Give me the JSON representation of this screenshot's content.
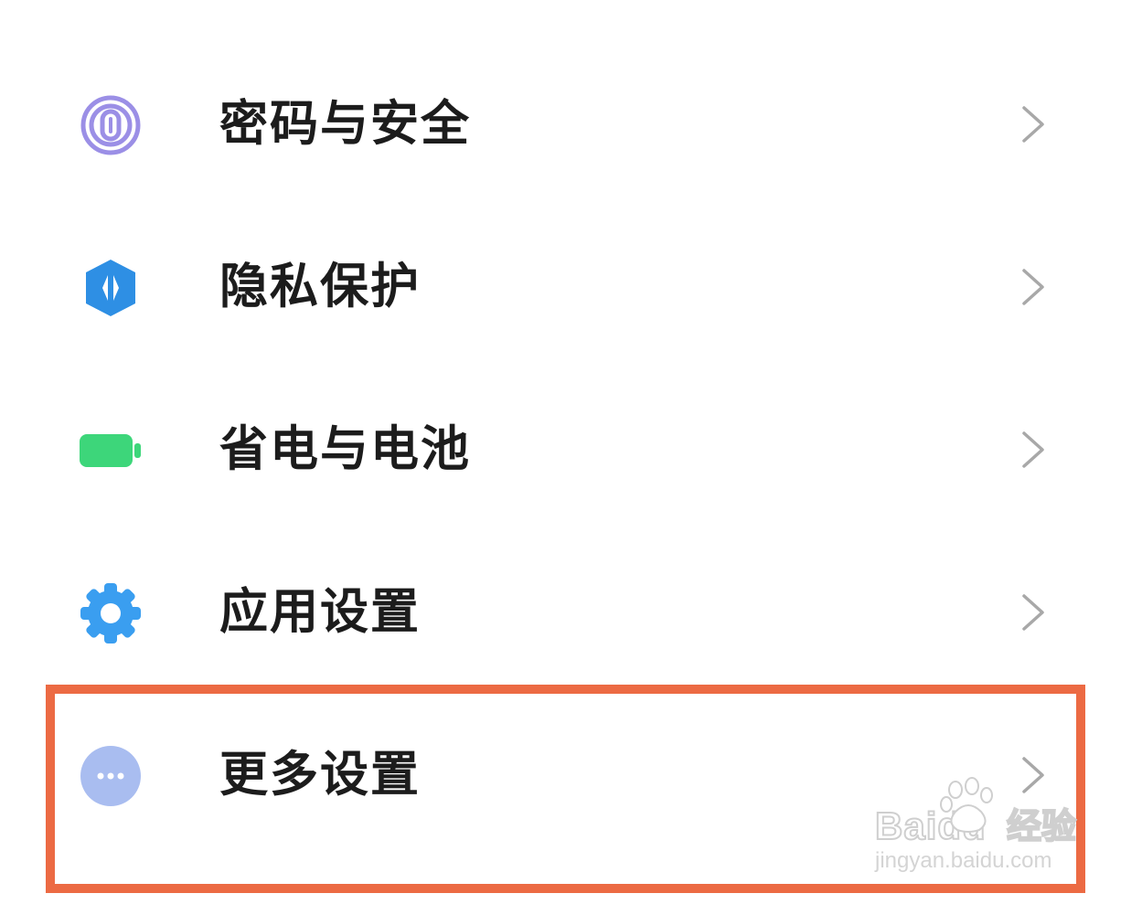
{
  "settings": {
    "items": [
      {
        "label": "密码与安全",
        "icon": "fingerprint-icon",
        "color": "#8b7fe0"
      },
      {
        "label": "隐私保护",
        "icon": "privacy-shield-icon",
        "color": "#2e8fe4"
      },
      {
        "label": "省电与电池",
        "icon": "battery-icon",
        "color": "#3dd67a"
      },
      {
        "label": "应用设置",
        "icon": "gear-icon",
        "color": "#3a9ef0"
      },
      {
        "label": "更多设置",
        "icon": "more-dots-icon",
        "color": "#a9bdf0"
      }
    ]
  },
  "highlight": {
    "color": "#ec6a43"
  },
  "watermark": {
    "brand": "Baidu",
    "product": "经验",
    "url": "jingyan.baidu.com"
  }
}
